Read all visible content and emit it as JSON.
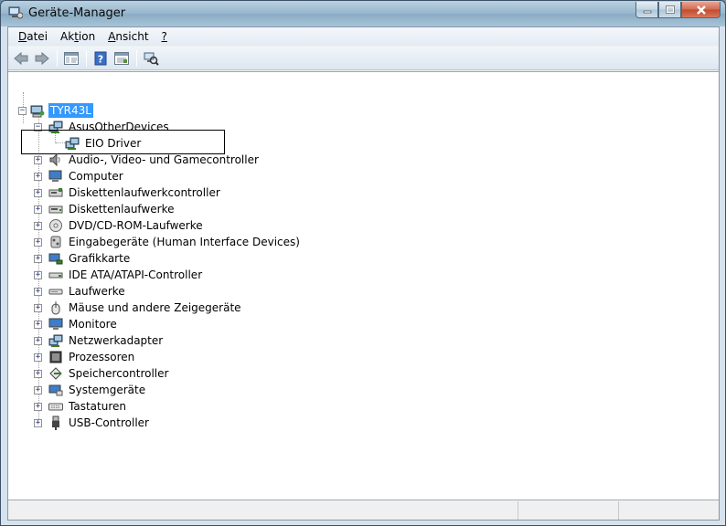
{
  "window": {
    "title": "Geräte-Manager",
    "icon": "device-manager-icon"
  },
  "caption_buttons": {
    "minimize_icon": "minimize-icon",
    "maximize_icon": "maximize-icon",
    "close_icon": "close-icon"
  },
  "menubar": {
    "items": [
      {
        "pre": "",
        "mnemonic": "D",
        "post": "atei"
      },
      {
        "pre": "Ak",
        "mnemonic": "t",
        "post": "ion"
      },
      {
        "pre": "",
        "mnemonic": "A",
        "post": "nsicht"
      },
      {
        "pre": "",
        "mnemonic": "?",
        "post": ""
      }
    ]
  },
  "toolbar": {
    "buttons": [
      "back-arrow-icon",
      "forward-arrow-icon",
      "show-hide-console-tree-icon",
      "help-icon",
      "properties-icon",
      "scan-hardware-icon"
    ]
  },
  "tree": {
    "root": {
      "label": "TYR43L",
      "icon": "computer-root-icon",
      "expanded": true
    },
    "expanded_group": {
      "label": "AsusOtherDevices",
      "icon": "network-device-icon",
      "expanded": true
    },
    "child": {
      "label": "EIO Driver",
      "icon": "network-device-icon"
    },
    "categories": [
      {
        "label": "Audio-, Video- und Gamecontroller",
        "icon": "speaker-icon"
      },
      {
        "label": "Computer",
        "icon": "computer-icon"
      },
      {
        "label": "Diskettenlaufwerkcontroller",
        "icon": "floppy-controller-icon"
      },
      {
        "label": "Diskettenlaufwerke",
        "icon": "floppy-drive-icon"
      },
      {
        "label": "DVD/CD-ROM-Laufwerke",
        "icon": "cdrom-icon"
      },
      {
        "label": "Eingabegeräte (Human Interface Devices)",
        "icon": "hid-icon"
      },
      {
        "label": "Grafikkarte",
        "icon": "display-adapter-icon"
      },
      {
        "label": "IDE ATA/ATAPI-Controller",
        "icon": "ide-controller-icon"
      },
      {
        "label": "Laufwerke",
        "icon": "disk-drive-icon"
      },
      {
        "label": "Mäuse und andere Zeigegeräte",
        "icon": "mouse-icon"
      },
      {
        "label": "Monitore",
        "icon": "monitor-icon"
      },
      {
        "label": "Netzwerkadapter",
        "icon": "network-adapter-icon"
      },
      {
        "label": "Prozessoren",
        "icon": "processor-icon"
      },
      {
        "label": "Speichercontroller",
        "icon": "storage-controller-icon"
      },
      {
        "label": "Systemgeräte",
        "icon": "system-devices-icon"
      },
      {
        "label": "Tastaturen",
        "icon": "keyboard-icon"
      },
      {
        "label": "USB-Controller",
        "icon": "usb-icon"
      }
    ]
  },
  "colors": {
    "selection": "#3399ff",
    "tree_background": "#ffffff",
    "close_button": "#c24a2e"
  }
}
